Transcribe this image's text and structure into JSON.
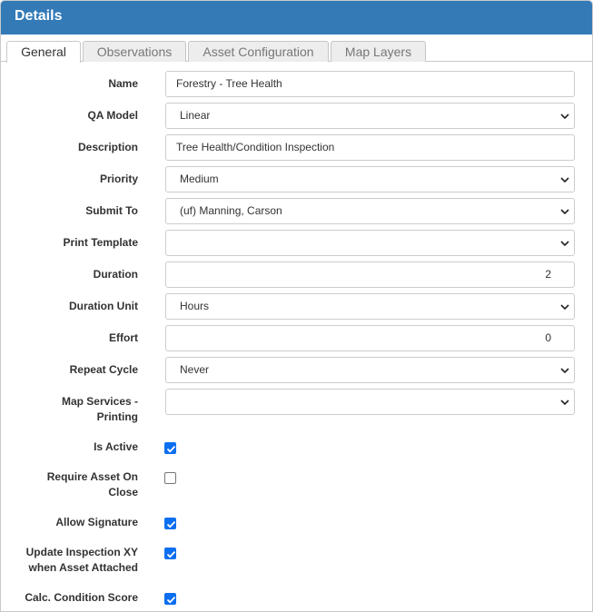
{
  "header": {
    "title": "Details"
  },
  "tabs": [
    {
      "label": "General",
      "active": true
    },
    {
      "label": "Observations",
      "active": false
    },
    {
      "label": "Asset Configuration",
      "active": false
    },
    {
      "label": "Map Layers",
      "active": false
    }
  ],
  "form": {
    "name": {
      "label": "Name",
      "value": "Forestry - Tree Health"
    },
    "qa_model": {
      "label": "QA Model",
      "value": "Linear"
    },
    "description": {
      "label": "Description",
      "value": "Tree Health/Condition Inspection"
    },
    "priority": {
      "label": "Priority",
      "value": "Medium"
    },
    "submit_to": {
      "label": "Submit To",
      "value": "(uf) Manning, Carson"
    },
    "print_template": {
      "label": "Print Template",
      "value": ""
    },
    "duration": {
      "label": "Duration",
      "value": "2"
    },
    "duration_unit": {
      "label": "Duration Unit",
      "value": "Hours"
    },
    "effort": {
      "label": "Effort",
      "value": "0"
    },
    "repeat_cycle": {
      "label": "Repeat Cycle",
      "value": "Never"
    },
    "map_services": {
      "label_line1": "Map Services -",
      "label_line2": "Printing",
      "value": ""
    },
    "is_active": {
      "label": "Is Active",
      "checked": true
    },
    "require_asset": {
      "label_line1": "Require Asset On",
      "label_line2": "Close",
      "checked": false
    },
    "allow_signature": {
      "label": "Allow Signature",
      "checked": true
    },
    "update_xy": {
      "label_line1": "Update Inspection XY",
      "label_line2": "when Asset Attached",
      "checked": true
    },
    "calc_condition": {
      "label": "Calc. Condition Score",
      "checked": true
    }
  },
  "colors": {
    "header_bg": "#337ab7",
    "checkbox_checked": "#0b6ff0",
    "tab_inactive_bg": "#ededed"
  },
  "icons": {
    "select_arrow": "chevron-down-icon",
    "checkbox_mark": "checkmark-icon"
  }
}
